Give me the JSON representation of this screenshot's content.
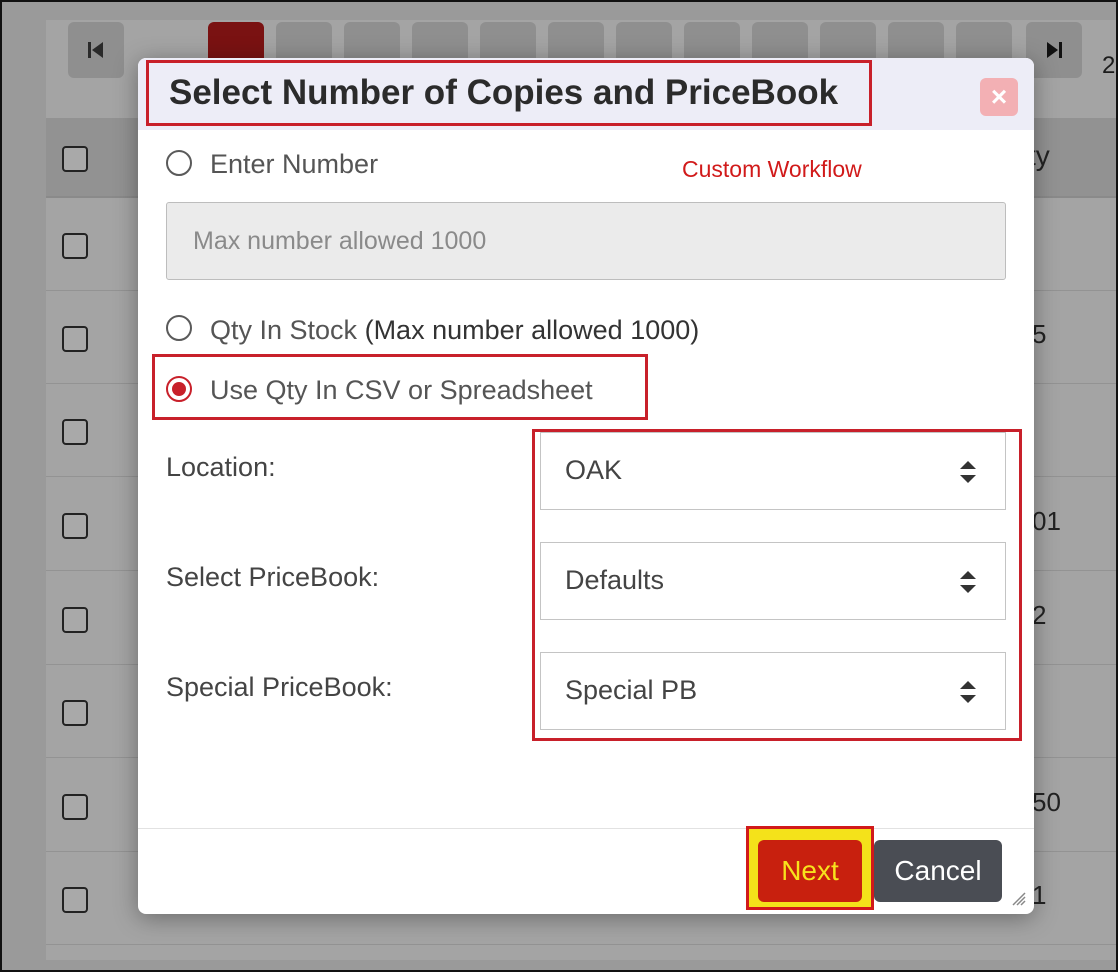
{
  "background": {
    "pager_count_partial": "2",
    "column_header_partial": "ty",
    "row_values_partial": [
      "",
      "5",
      "",
      "01",
      "2",
      "",
      "50",
      "1"
    ]
  },
  "dialog": {
    "title": "Select Number of Copies and PriceBook",
    "close_label": "×",
    "annotation": "Custom Workflow",
    "options": {
      "enter_number": "Enter Number",
      "number_placeholder": "Max number allowed 1000",
      "qty_in_stock": "Qty In Stock",
      "qty_in_stock_note": "(Max number allowed 1000)",
      "use_csv": "Use Qty In CSV or Spreadsheet",
      "selected": "use_csv"
    },
    "fields": {
      "location_label": "Location:",
      "location_value": "OAK",
      "pricebook_label": "Select PriceBook:",
      "pricebook_value": "Defaults",
      "special_label": "Special PriceBook:",
      "special_value": "Special PB"
    },
    "buttons": {
      "next": "Next",
      "cancel": "Cancel"
    }
  },
  "colors": {
    "accent_red": "#c8202a",
    "next_bg": "#c8200e",
    "next_text": "#f7e21d",
    "highlight_yellow": "#f4e21a",
    "cancel_bg": "#4a4d54"
  }
}
